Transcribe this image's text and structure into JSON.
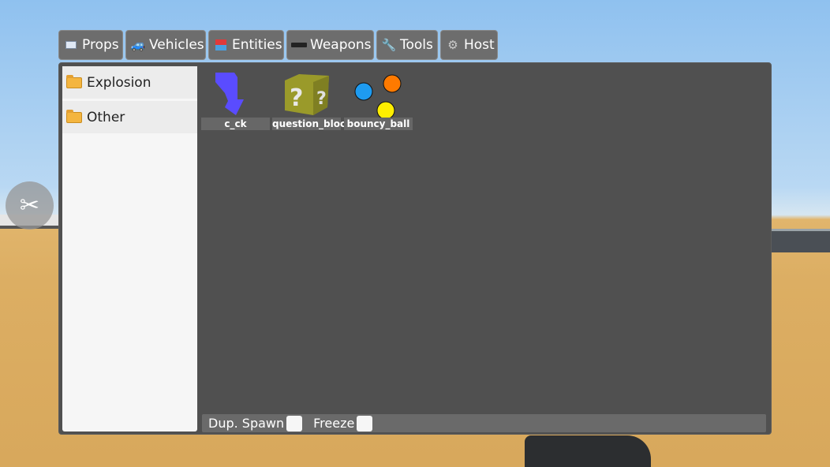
{
  "tabs": [
    {
      "label": "Props",
      "icon": "props-icon"
    },
    {
      "label": "Vehicles",
      "icon": "car-icon"
    },
    {
      "label": "Entities",
      "icon": "blocks-icon"
    },
    {
      "label": "Weapons",
      "icon": "pistol-icon"
    },
    {
      "label": "Tools",
      "icon": "wrench-icon"
    },
    {
      "label": "Host",
      "icon": "gear-icon"
    }
  ],
  "sidebar": {
    "categories": [
      {
        "label": "Explosion"
      },
      {
        "label": "Other"
      }
    ]
  },
  "items": [
    {
      "label": "c_ck"
    },
    {
      "label": "question_block"
    },
    {
      "label": "bouncy_ball"
    }
  ],
  "bottom": {
    "dup_spawn_label": "Dup. Spawn",
    "dup_spawn_checked": false,
    "freeze_label": "Freeze",
    "freeze_checked": false
  },
  "colors": {
    "ball_blue": "#1e9bf0",
    "ball_orange": "#ff7a00",
    "ball_yellow": "#ffee00",
    "ck_purple": "#5a4cff"
  }
}
